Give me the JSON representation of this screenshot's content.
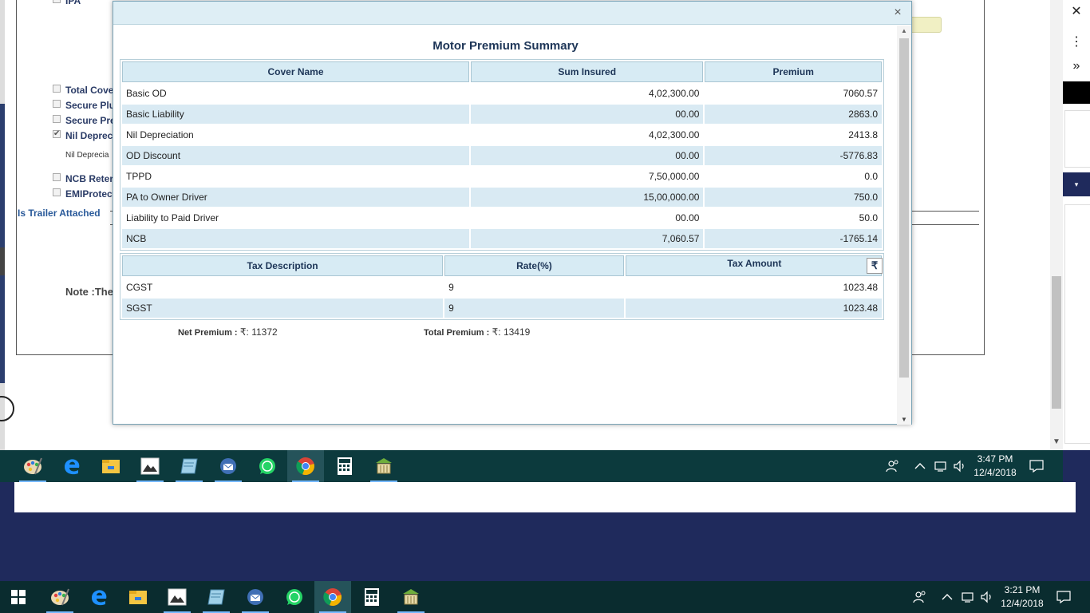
{
  "background_form": {
    "checkboxes": [
      {
        "label": "IPA",
        "checked": false
      },
      {
        "label": "Total Cove",
        "checked": false
      },
      {
        "label": "Secure Plu",
        "checked": false
      },
      {
        "label": "Secure Pre",
        "checked": false
      },
      {
        "label": "Nil Deprec",
        "checked": true
      },
      {
        "label": "NCB Reter",
        "checked": false
      },
      {
        "label": "EMIProtect",
        "checked": false
      }
    ],
    "nil_depreciation_sub_label": "Nil Deprecia",
    "trailer_label": "Is Trailer Attached",
    "note_label": "Note :The"
  },
  "modal": {
    "title": "Motor Premium Summary",
    "close_symbol": "×",
    "cover_table": {
      "headers": [
        "Cover Name",
        "Sum Insured",
        "Premium"
      ],
      "rows": [
        {
          "name": "Basic OD",
          "sum_insured": "4,02,300.00",
          "premium": "7060.57"
        },
        {
          "name": "Basic Liability",
          "sum_insured": "00.00",
          "premium": "2863.0"
        },
        {
          "name": "Nil Depreciation",
          "sum_insured": "4,02,300.00",
          "premium": "2413.8"
        },
        {
          "name": "OD Discount",
          "sum_insured": "00.00",
          "premium": "-5776.83"
        },
        {
          "name": "TPPD",
          "sum_insured": "7,50,000.00",
          "premium": "0.0"
        },
        {
          "name": "PA to Owner Driver",
          "sum_insured": "15,00,000.00",
          "premium": "750.0"
        },
        {
          "name": "Liability to Paid Driver",
          "sum_insured": "00.00",
          "premium": "50.0"
        },
        {
          "name": "NCB",
          "sum_insured": "7,060.57",
          "premium": "-1765.14"
        }
      ]
    },
    "tax_table": {
      "headers": [
        "Tax Description",
        "Rate(%)",
        "Tax Amount"
      ],
      "currency_symbol": "₹",
      "rows": [
        {
          "description": "CGST",
          "rate": "9",
          "amount": "1023.48"
        },
        {
          "description": "SGST",
          "rate": "9",
          "amount": "1023.48"
        }
      ]
    },
    "net_premium_label": "Net Premium :",
    "net_premium_value": "₹: 11372",
    "total_premium_label": "Total Premium :",
    "total_premium_value": "₹: 13419"
  },
  "side_panel": {
    "close_symbol": "✕",
    "menu_symbol": "⋮",
    "expand_symbol": "»",
    "dropdown_symbol": "▾"
  },
  "inner_taskbar": {
    "time": "3:47 PM",
    "date": "12/4/2018",
    "apps": [
      "paint-app",
      "edge-browser",
      "file-explorer",
      "photos",
      "notepad-app",
      "thunderbird-mail",
      "whatsapp",
      "chrome-browser",
      "calculator",
      "accounting-app"
    ],
    "active_app": "chrome-browser"
  },
  "outer_taskbar": {
    "time": "3:21 PM",
    "date": "12/4/2018",
    "active_app": "chrome-browser"
  },
  "colors": {
    "modal_header_bg": "#d7ebf4",
    "row_alt_bg": "#d9eaf3",
    "title_color": "#1d3557",
    "taskbar_bg": "#0c3a3d",
    "desktop_bg": "#1f2a5c"
  }
}
